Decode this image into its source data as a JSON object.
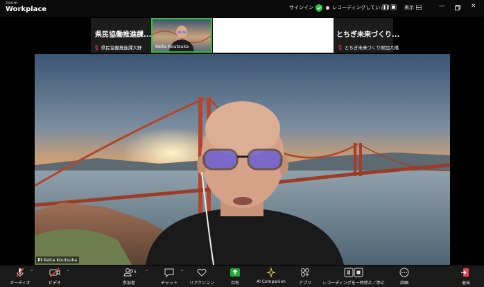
{
  "app": {
    "brand_top": "zoom",
    "brand_bottom": "Workplace"
  },
  "titlebar": {
    "signin": "サインイン",
    "recording": "レコーディングしています...",
    "view": "表示"
  },
  "thumbnails": [
    {
      "big_name": "県民協働推進課...",
      "small_name": "県民協働推進課大野"
    },
    {
      "small_name": "Keita Koutsuka"
    },
    {
      "big_name": "とちぎ未来づくり...",
      "small_name": "とちぎ未来づくり財団大橋"
    }
  ],
  "main_video": {
    "participant_name": "Keita Koutsuka"
  },
  "toolbar": {
    "audio": "オーディオ",
    "video": "ビデオ",
    "participants": "参加者",
    "participants_count": "5",
    "chat": "チャット",
    "reactions": "リアクション",
    "share": "共有",
    "ai": "AI Companion",
    "apps": "アプリ",
    "recording_ctrl": "レコーディングを一時停止／停止",
    "more": "詳細",
    "leave": "退出"
  },
  "colors": {
    "active_border": "#2ac33f",
    "share_green": "#23a83a",
    "muted_red": "#e54848",
    "leave_red": "#e5484d"
  }
}
